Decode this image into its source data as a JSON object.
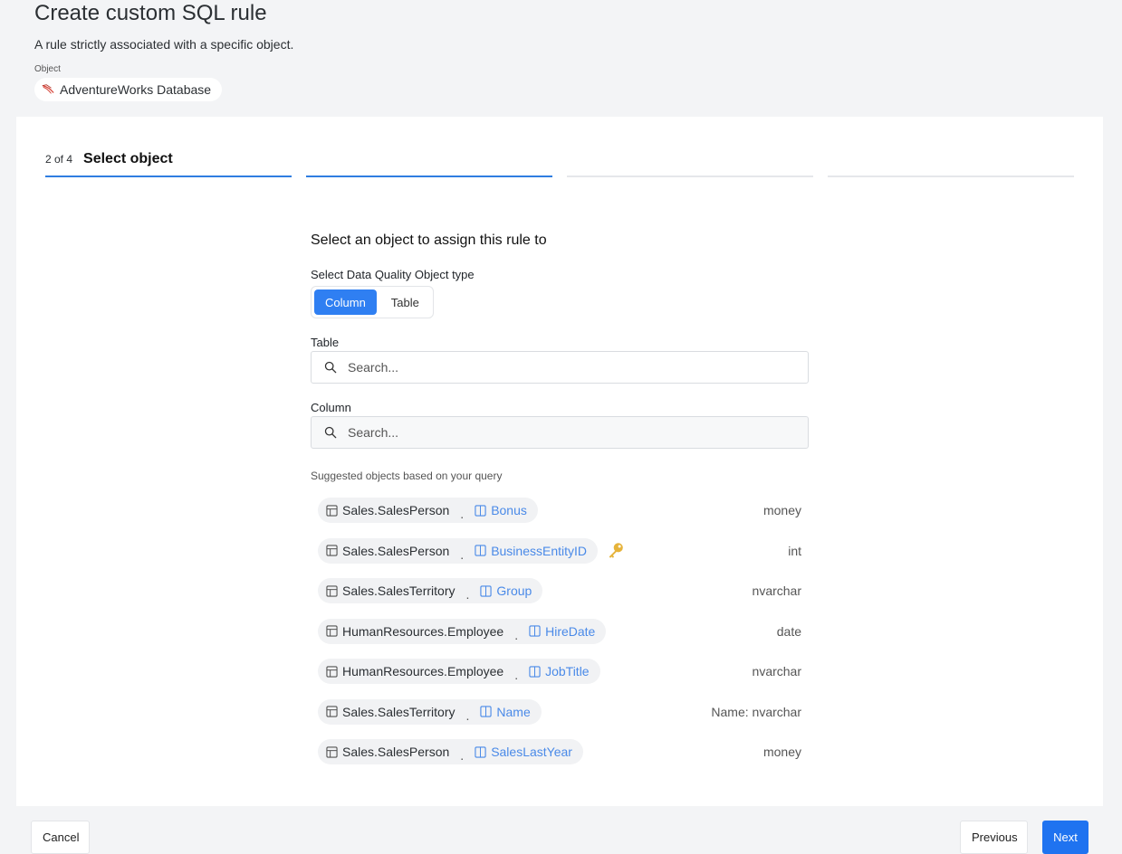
{
  "header": {
    "title": "Create custom SQL rule",
    "subtitle": "A rule strictly associated with a specific object.",
    "object_label": "Object",
    "object_name": "AdventureWorks Database",
    "object_icon": "database-logo-icon"
  },
  "stepper": {
    "count": "2 of 4",
    "name": "Select object",
    "total_steps": 4,
    "current_step": 2
  },
  "form": {
    "heading": "Select an object to assign this rule to",
    "type_label": "Select Data Quality Object type",
    "type_options": [
      "Column",
      "Table"
    ],
    "type_selected": "Column",
    "table_label": "Table",
    "table_placeholder": "Search...",
    "column_label": "Column",
    "column_placeholder": "Search...",
    "suggest_label": "Suggested objects based on your query"
  },
  "suggestions": [
    {
      "table": "Sales.SalesPerson",
      "column": "Bonus",
      "type": "money",
      "key": false
    },
    {
      "table": "Sales.SalesPerson",
      "column": "BusinessEntityID",
      "type": "int",
      "key": true
    },
    {
      "table": "Sales.SalesTerritory",
      "column": "Group",
      "type": "nvarchar",
      "key": false
    },
    {
      "table": "HumanResources.Employee",
      "column": "HireDate",
      "type": "date",
      "key": false
    },
    {
      "table": "HumanResources.Employee",
      "column": "JobTitle",
      "type": "nvarchar",
      "key": false
    },
    {
      "table": "Sales.SalesTerritory",
      "column": "Name",
      "type": "Name: nvarchar",
      "key": false
    },
    {
      "table": "Sales.SalesPerson",
      "column": "SalesLastYear",
      "type": "money",
      "key": false
    }
  ],
  "footer": {
    "cancel_label": "Cancel",
    "previous_label": "Previous",
    "next_label": "Next"
  },
  "colors": {
    "accent": "#2f7ff2",
    "column_link": "#4a8ae8",
    "key": "#e6b33a"
  }
}
